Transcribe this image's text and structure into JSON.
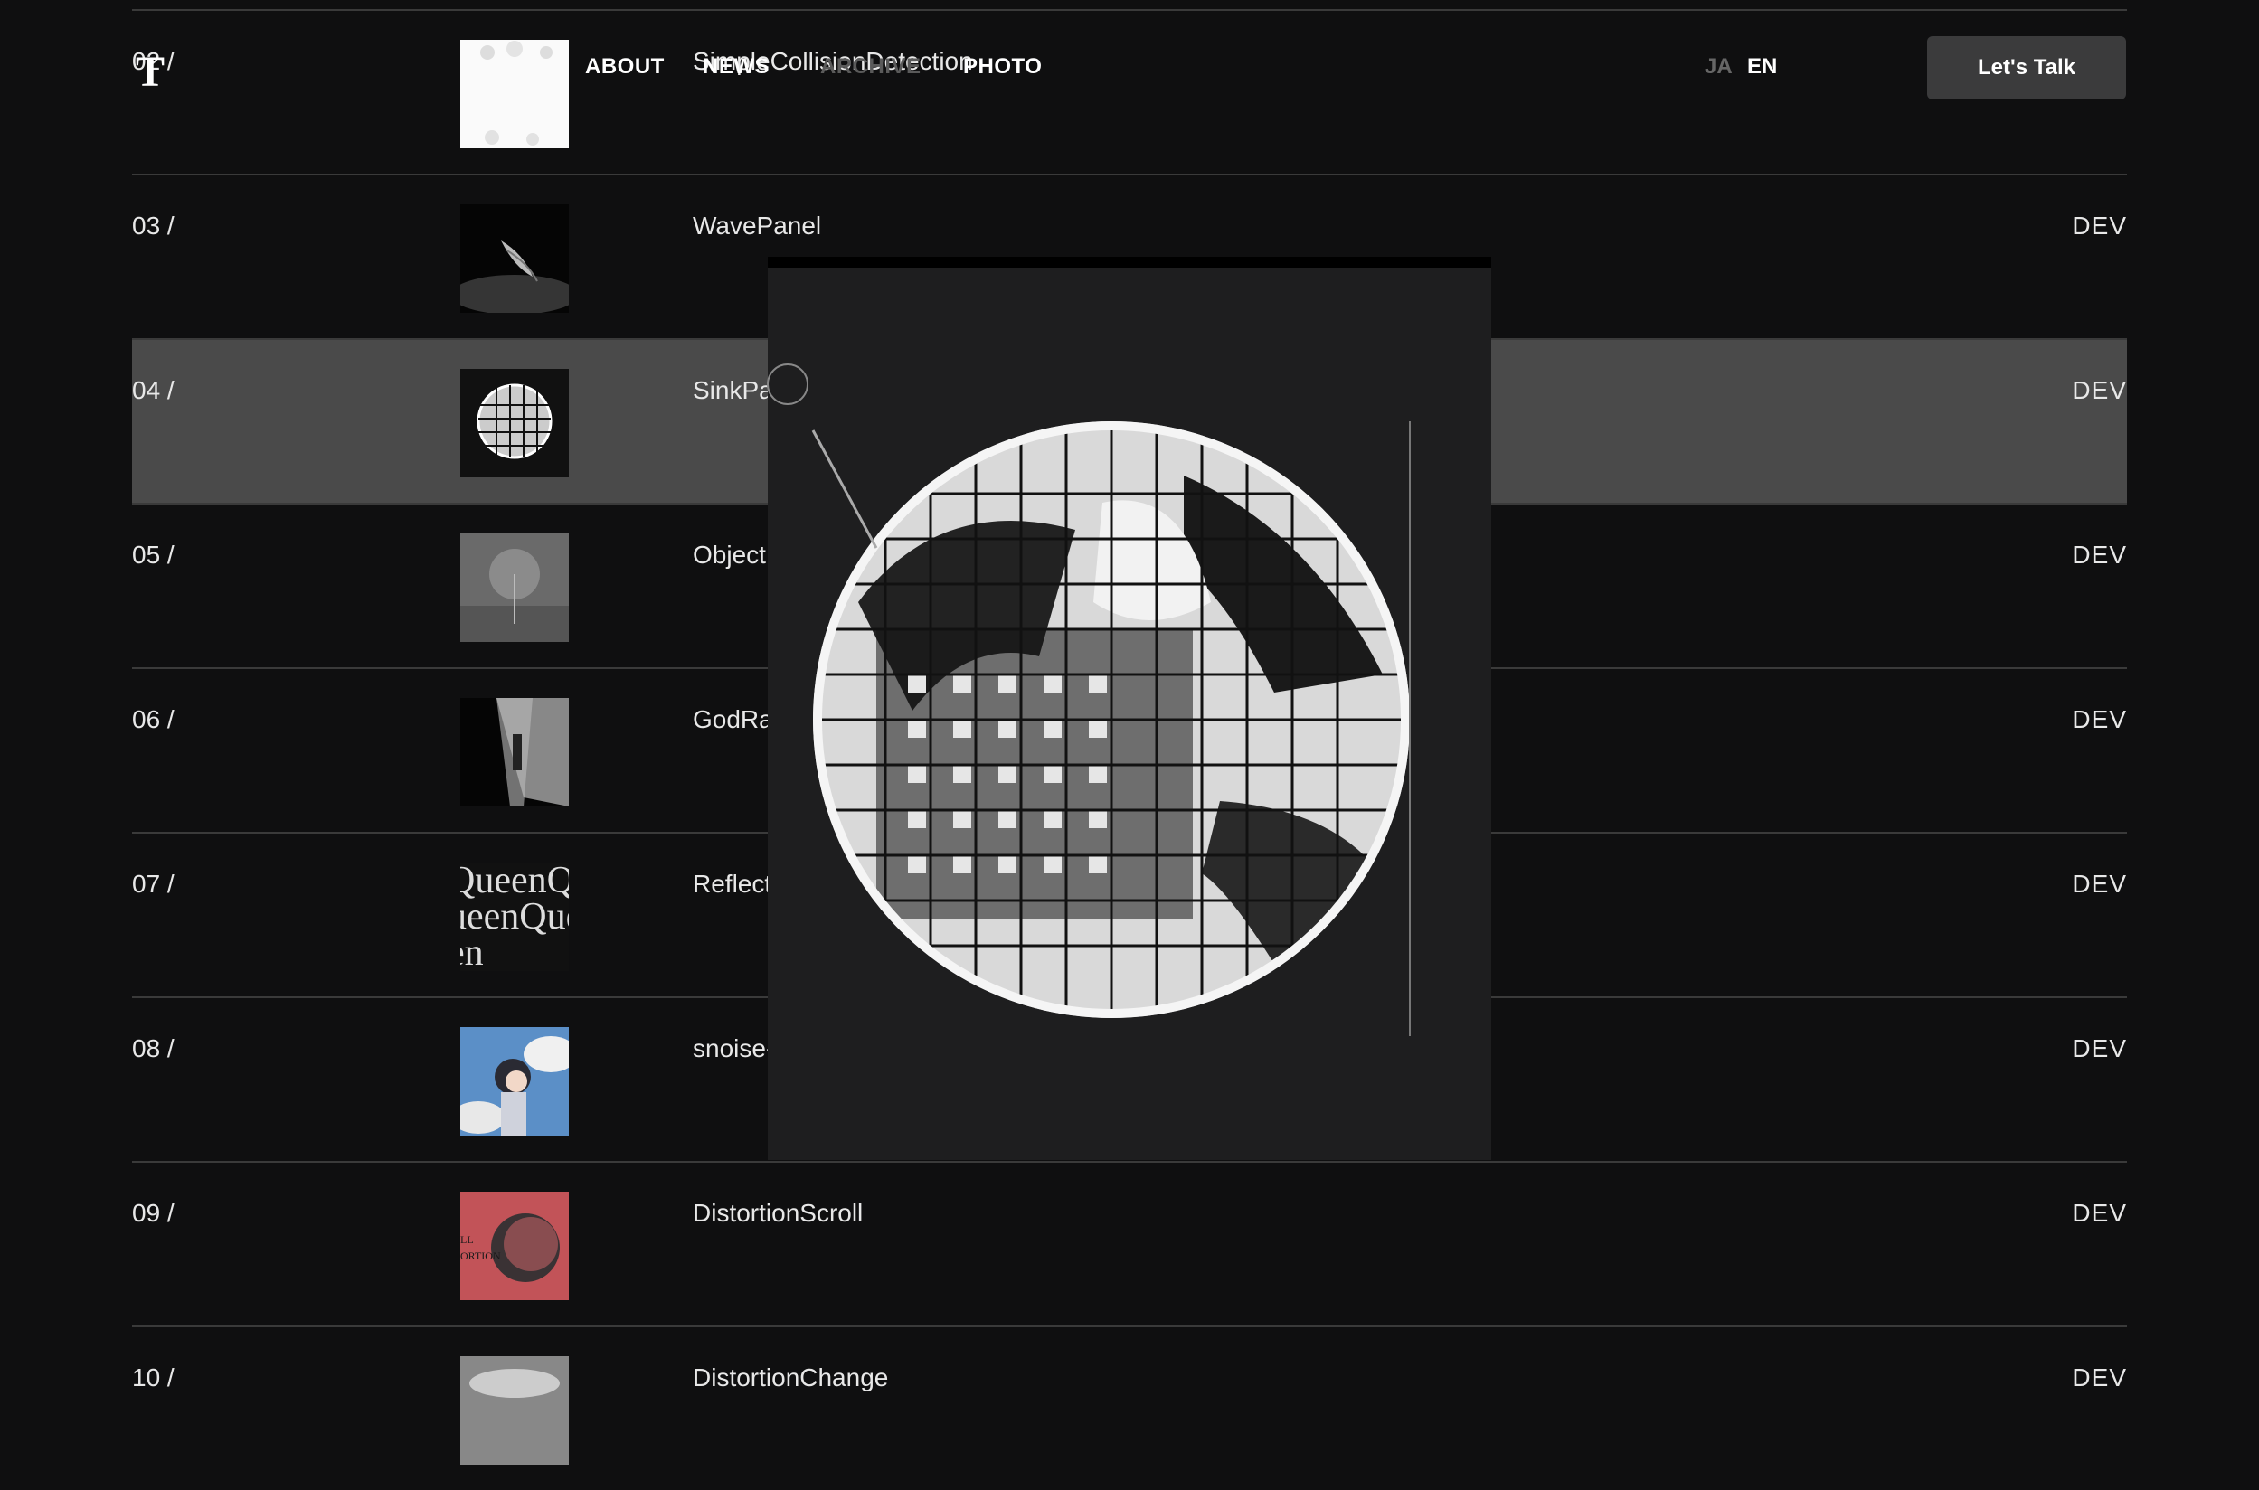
{
  "header": {
    "logo": "T",
    "nav": [
      {
        "label": "ABOUT",
        "dim": false
      },
      {
        "label": "NEWS",
        "dim": false
      },
      {
        "label": "ARCHIVE",
        "dim": true
      },
      {
        "label": "PHOTO",
        "dim": false
      }
    ],
    "lang": {
      "ja": "JA",
      "en": "EN"
    },
    "cta": "Let's Talk"
  },
  "rows": [
    {
      "num": "02 /",
      "title": "SimpleCollisionDetection",
      "tag": "",
      "thumb": "collision-thumb"
    },
    {
      "num": "03 /",
      "title": "WavePanel",
      "tag": "DEV",
      "thumb": "wave-thumb"
    },
    {
      "num": "04 /",
      "title": "SinkPa",
      "tag": "DEV",
      "thumb": "sphere-thumb",
      "active": true
    },
    {
      "num": "05 /",
      "title": "Object",
      "tag": "DEV",
      "thumb": "tree-thumb"
    },
    {
      "num": "06 /",
      "title": "GodRa",
      "tag": "DEV",
      "thumb": "godray-thumb"
    },
    {
      "num": "07 /",
      "title": "Reflect",
      "tag": "DEV",
      "thumb": "queen-thumb"
    },
    {
      "num": "08 /",
      "title": "snoise-",
      "tag": "DEV",
      "thumb": "anime-thumb"
    },
    {
      "num": "09 /",
      "title": "DistortionScroll",
      "tag": "DEV",
      "thumb": "distortion-thumb"
    },
    {
      "num": "10 /",
      "title": "DistortionChange",
      "tag": "DEV",
      "thumb": "change-thumb"
    }
  ],
  "thumb_text": {
    "queen": "QueenQueenQueen",
    "distortion_line1": "LL",
    "distortion_line2": "ORTION"
  },
  "colors": {
    "background": "#0f0f10",
    "active_row": "#4a4a4a",
    "button": "#3b3b3c"
  }
}
